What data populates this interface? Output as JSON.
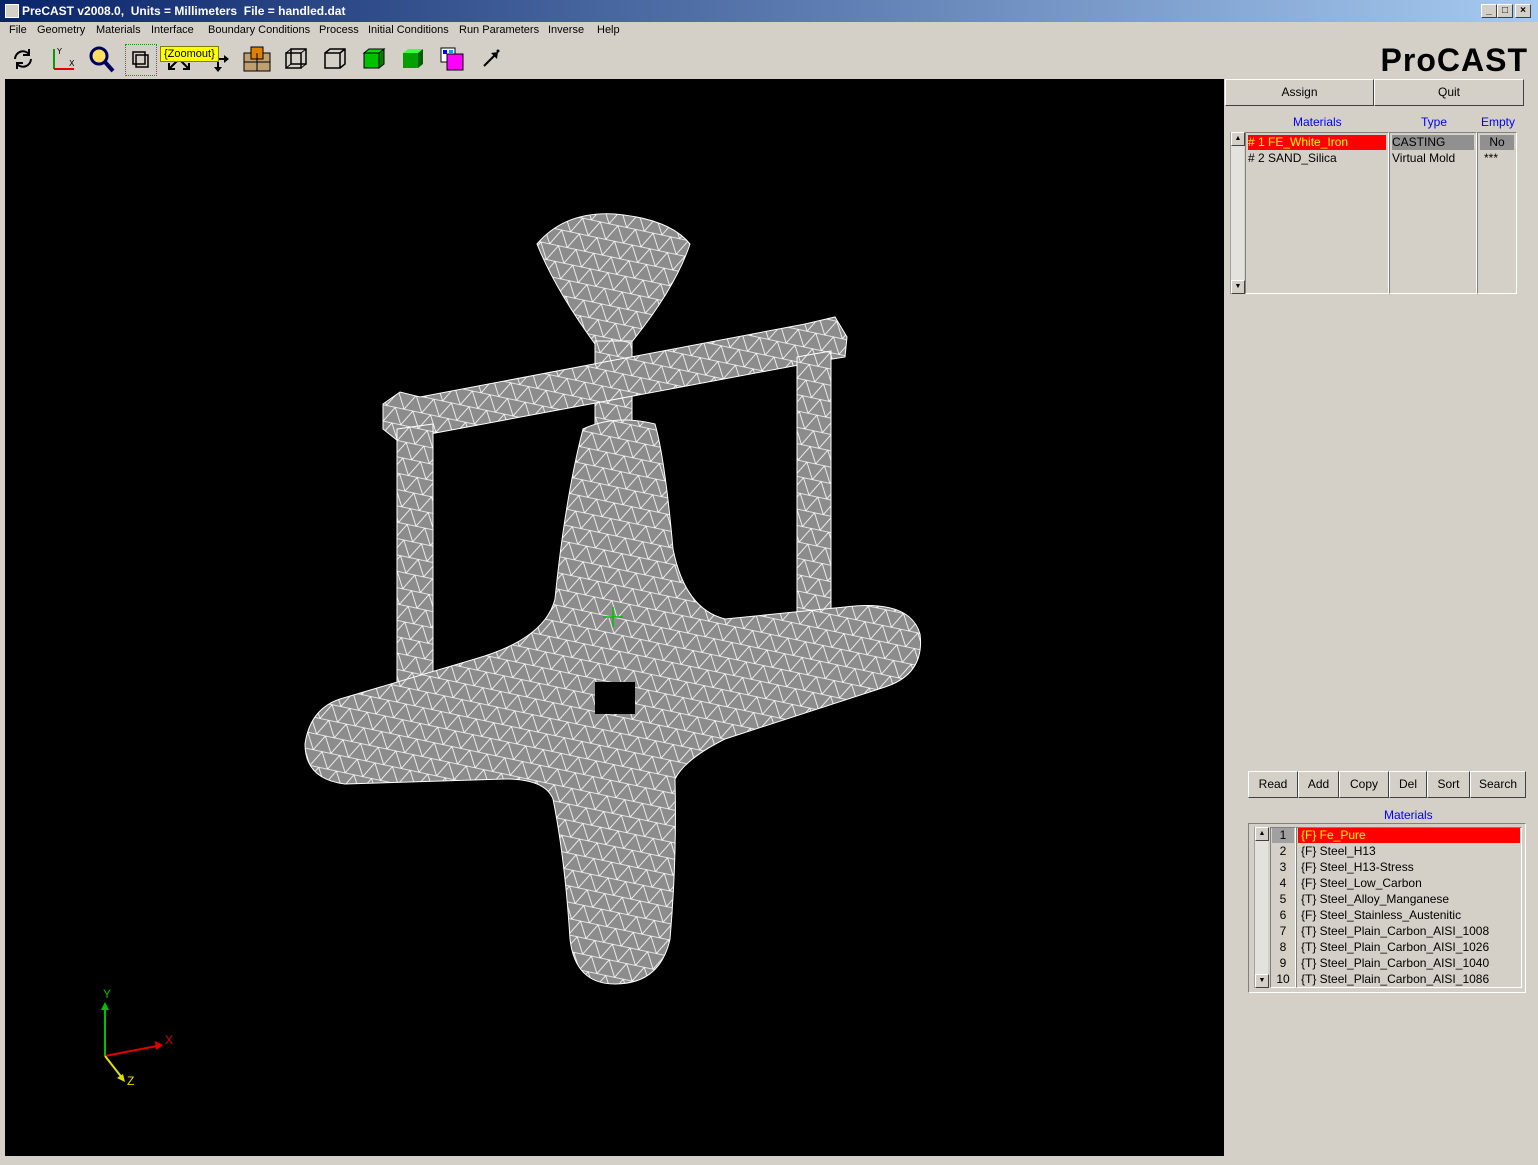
{
  "window": {
    "title": "PreCAST v2008.0,  Units = Millimeters  File = handled.dat",
    "min_label": "_",
    "max_label": "□",
    "close_label": "×"
  },
  "menu": [
    "File",
    "Geometry",
    "Materials",
    "Interface",
    "Boundary Conditions",
    "Process",
    "Initial Conditions",
    "Run Parameters",
    "Inverse",
    "Help"
  ],
  "toolbar": {
    "brand": "ProCAST",
    "tooltip": "{Zoomout}",
    "icons": [
      "rotate-icon",
      "axes-icon",
      "zoom-icon",
      "zoomout-icon",
      "pan-icon",
      "translate-icon",
      "mesh-icon",
      "wireframe-icon",
      "outline-icon",
      "solid-icon",
      "shaded-icon",
      "material-color-icon",
      "pick-icon"
    ]
  },
  "assignment": {
    "assign_label": "Assign",
    "quit_label": "Quit",
    "headers": {
      "materials": "Materials",
      "type": "Type",
      "empty": "Empty"
    },
    "rows": [
      {
        "name": "# 1 FE_White_Iron",
        "type": "CASTING",
        "empty": "No",
        "selected": true
      },
      {
        "name": "# 2 SAND_Silica",
        "type": "Virtual Mold",
        "empty": "***",
        "selected": false
      }
    ]
  },
  "database": {
    "buttons": [
      "Read",
      "Add",
      "Copy",
      "Del",
      "Sort",
      "Search"
    ],
    "header": "Materials",
    "rows": [
      {
        "num": "1",
        "name": "{F}  Fe_Pure",
        "selected": true
      },
      {
        "num": "2",
        "name": "{F}  Steel_H13",
        "selected": false
      },
      {
        "num": "3",
        "name": "{F}  Steel_H13-Stress",
        "selected": false
      },
      {
        "num": "4",
        "name": "{F}  Steel_Low_Carbon",
        "selected": false
      },
      {
        "num": "5",
        "name": "{T}  Steel_Alloy_Manganese",
        "selected": false
      },
      {
        "num": "6",
        "name": "{F}  Steel_Stainless_Austenitic",
        "selected": false
      },
      {
        "num": "7",
        "name": "{T}  Steel_Plain_Carbon_AISI_1008",
        "selected": false
      },
      {
        "num": "8",
        "name": "{T}  Steel_Plain_Carbon_AISI_1026",
        "selected": false
      },
      {
        "num": "9",
        "name": "{T}  Steel_Plain_Carbon_AISI_1040",
        "selected": false
      },
      {
        "num": "10",
        "name": "{T}  Steel_Plain_Carbon_AISI_1086",
        "selected": false
      }
    ]
  },
  "axes": {
    "x": "X",
    "y": "Y",
    "z": "Z"
  },
  "colors": {
    "mesh_fill": "#8c8c8c",
    "mesh_line": "#ffffff",
    "selection": "#ff0000",
    "header_text": "#0000ff"
  }
}
